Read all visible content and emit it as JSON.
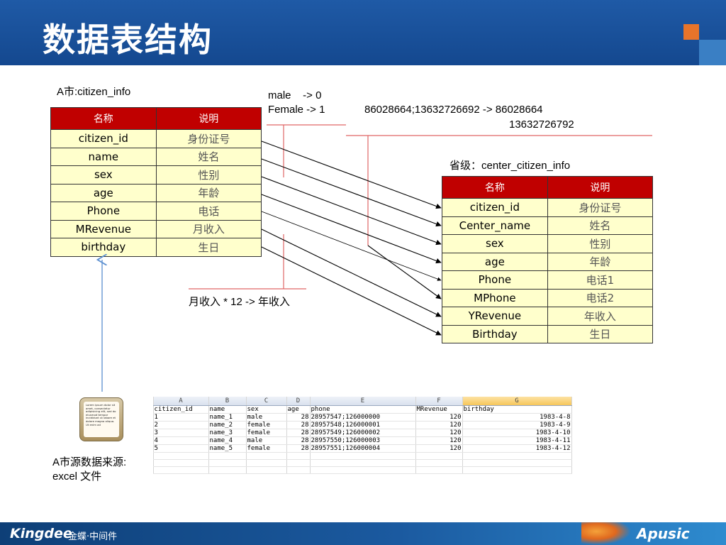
{
  "header": {
    "title": "数据表结构"
  },
  "labels": {
    "city_table_title": "A市:citizen_info",
    "province_table_title": "省级：center_citizen_info",
    "sex_rule_line1": "male    -> 0",
    "sex_rule_line2": "Female -> 1",
    "phone_rule_line1": "86028664;13632726692 -> 86028664",
    "phone_rule_line2": "13632726792",
    "revenue_rule": "月收入 * 12 -> 年收入",
    "source_line1": "A市源数据来源:",
    "source_line2": "excel 文件"
  },
  "table_a": {
    "headers": [
      "名称",
      "说明"
    ],
    "rows": [
      [
        "citizen_id",
        "身份证号"
      ],
      [
        "name",
        "姓名"
      ],
      [
        "sex",
        "性别"
      ],
      [
        "age",
        "年龄"
      ],
      [
        "Phone",
        "电话"
      ],
      [
        "MRevenue",
        "月收入"
      ],
      [
        "birthday",
        "生日"
      ]
    ]
  },
  "table_b": {
    "headers": [
      "名称",
      "说明"
    ],
    "rows": [
      [
        "citizen_id",
        "身份证号"
      ],
      [
        "Center_name",
        "姓名"
      ],
      [
        "sex",
        "性别"
      ],
      [
        "age",
        "年龄"
      ],
      [
        "Phone",
        "电话1"
      ],
      [
        "MPhone",
        "电话2"
      ],
      [
        "YRevenue",
        "年收入"
      ],
      [
        "Birthday",
        "生日"
      ]
    ]
  },
  "doc_icon_text": "Lorem ipsum dolor sit amet, consectetur adipisicing elit, sed do eiusmod tempor incididunt ut labore et dolore magna aliqua. Ut enim ad",
  "sheet": {
    "col_letters": [
      "",
      "A",
      "B",
      "C",
      "D",
      "E",
      "F",
      "G"
    ],
    "rows": [
      [
        "citizen_id",
        "name",
        "sex",
        "age",
        "phone",
        "MRevenue",
        "birthday"
      ],
      [
        "1",
        "name_1",
        "male",
        "28",
        "28957547;126000000",
        "120",
        "1983-4-8"
      ],
      [
        "2",
        "name_2",
        "female",
        "28",
        "28957548;126000001",
        "120",
        "1983-4-9"
      ],
      [
        "3",
        "name_3",
        "female",
        "28",
        "28957549;126000002",
        "120",
        "1983-4-10"
      ],
      [
        "4",
        "name_4",
        "male",
        "28",
        "28957550;126000003",
        "120",
        "1983-4-11"
      ],
      [
        "5",
        "name_5",
        "female",
        "28",
        "28957551;126000004",
        "120",
        "1983-4-12"
      ]
    ]
  },
  "footer": {
    "logo": "Kingdee",
    "subtitle": "金蝶·中间件",
    "brand": "Apusic"
  },
  "colors": {
    "header_bg": "#1f5aa6",
    "table_header": "#c00000",
    "table_body": "#ffffcc",
    "rule_line": "#e06666",
    "source_arrow": "#5b8fd0"
  }
}
